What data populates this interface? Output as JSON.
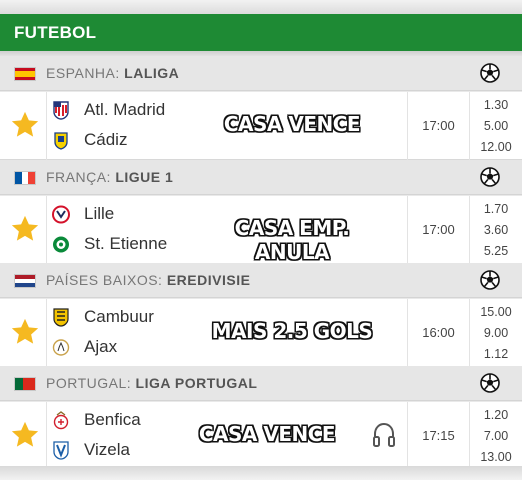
{
  "header": {
    "title": "FUTEBOL"
  },
  "colors": {
    "header_green": "#1e8a34",
    "star": "#f5b921"
  },
  "leagues": [
    {
      "country": "ESPANHA:",
      "league": "LALIGA",
      "flag_icon": "spain-flag-icon",
      "match": {
        "home": "Atl. Madrid",
        "away": "Cádiz",
        "home_icon": "atletico-madrid-crest-icon",
        "away_icon": "cadiz-crest-icon",
        "tip": "CASA VENCE",
        "time": "17:00",
        "odds": [
          "1.30",
          "5.00",
          "12.00"
        ]
      }
    },
    {
      "country": "FRANÇA:",
      "league": "LIGUE 1",
      "flag_icon": "france-flag-icon",
      "match": {
        "home": "Lille",
        "away": "St. Etienne",
        "home_icon": "lille-crest-icon",
        "away_icon": "st-etienne-crest-icon",
        "tip": "CASA EMP. ANULA",
        "time": "17:00",
        "odds": [
          "1.70",
          "3.60",
          "5.25"
        ]
      }
    },
    {
      "country": "PAÍSES BAIXOS:",
      "league": "EREDIVISIE",
      "flag_icon": "netherlands-flag-icon",
      "match": {
        "home": "Cambuur",
        "away": "Ajax",
        "home_icon": "cambuur-crest-icon",
        "away_icon": "ajax-crest-icon",
        "tip": "MAIS 2.5 GOLS",
        "time": "16:00",
        "odds": [
          "15.00",
          "9.00",
          "1.12"
        ]
      }
    },
    {
      "country": "PORTUGAL:",
      "league": "LIGA PORTUGAL",
      "flag_icon": "portugal-flag-icon",
      "match": {
        "home": "Benfica",
        "away": "Vizela",
        "home_icon": "benfica-crest-icon",
        "away_icon": "vizela-crest-icon",
        "tip": "CASA VENCE",
        "time": "17:15",
        "odds": [
          "1.20",
          "7.00",
          "13.00"
        ],
        "live_audio_icon": "headphones-icon"
      }
    }
  ]
}
